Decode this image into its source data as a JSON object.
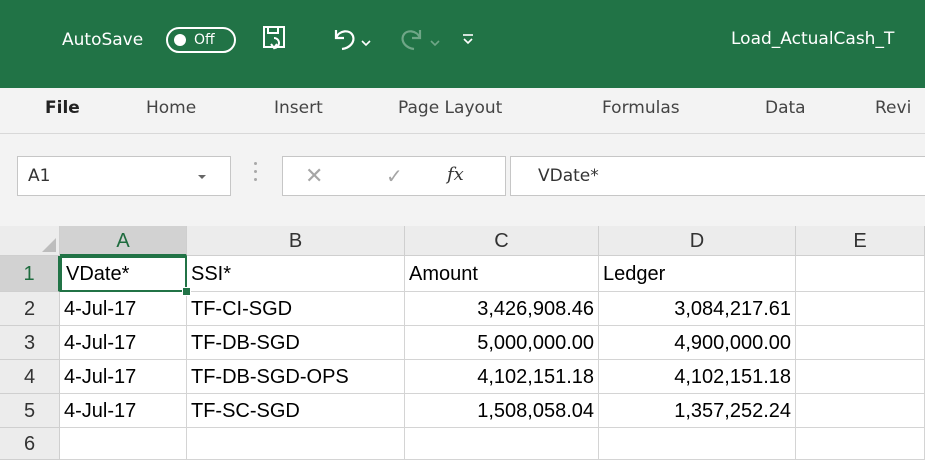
{
  "titlebar": {
    "autosave_label": "AutoSave",
    "autosave_state": "Off",
    "file_title": "Load_ActualCash_T",
    "icons": [
      "save-icon",
      "undo-icon",
      "redo-icon",
      "customize-qat-icon"
    ]
  },
  "ribbon": {
    "tabs": [
      "File",
      "Home",
      "Insert",
      "Page Layout",
      "Formulas",
      "Data",
      "Revi"
    ]
  },
  "formula_bar": {
    "name_box": "A1",
    "fx_label": "fx",
    "content": "VDate*"
  },
  "sheet": {
    "columns": [
      "A",
      "B",
      "C",
      "D",
      "E"
    ],
    "rows": [
      "1",
      "2",
      "3",
      "4",
      "5",
      "6"
    ],
    "cells": [
      [
        "VDate*",
        "SSI*",
        "Amount",
        "Ledger",
        ""
      ],
      [
        "4-Jul-17",
        "TF-CI-SGD",
        "3,426,908.46",
        "3,084,217.61",
        ""
      ],
      [
        "4-Jul-17",
        "TF-DB-SGD",
        "5,000,000.00",
        "4,900,000.00",
        ""
      ],
      [
        "4-Jul-17",
        "TF-DB-SGD-OPS",
        "4,102,151.18",
        "4,102,151.18",
        ""
      ],
      [
        "4-Jul-17",
        "TF-SC-SGD",
        "1,508,058.04",
        "1,357,252.24",
        ""
      ],
      [
        "",
        "",
        "",
        "",
        ""
      ]
    ],
    "active_cell": "A1"
  },
  "colors": {
    "title_bar": "#217346",
    "ribbon_bg": "#f3f3f3",
    "selection": "#217346"
  }
}
